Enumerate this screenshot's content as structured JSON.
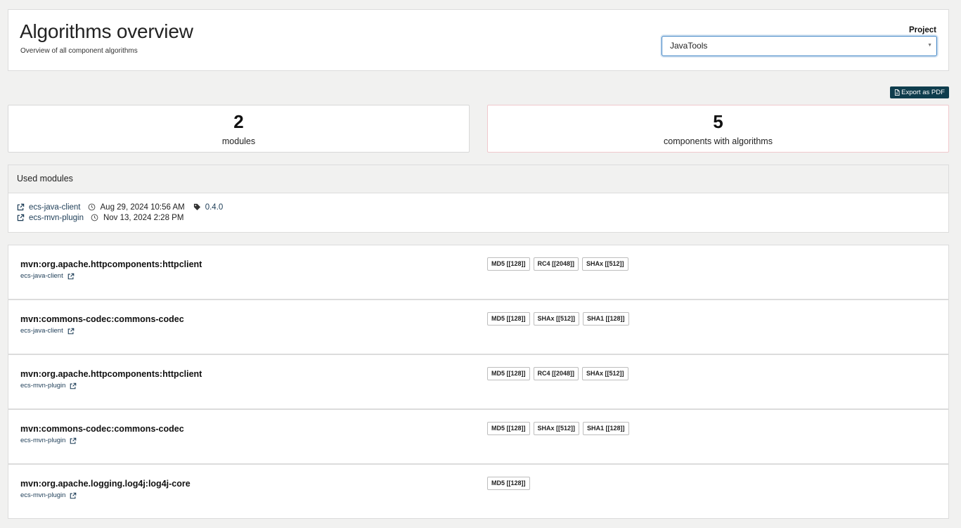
{
  "header": {
    "title": "Algorithms overview",
    "subtitle": "Overview of all component algorithms",
    "project_label": "Project",
    "project_value": "JavaTools"
  },
  "toolbar": {
    "export_label": "Export as PDF"
  },
  "stats": {
    "modules": {
      "value": "2",
      "label": "modules"
    },
    "components": {
      "value": "5",
      "label": "components with algorithms"
    }
  },
  "used_modules": {
    "title": "Used modules",
    "items": [
      {
        "name": "ecs-java-client",
        "date": "Aug 29, 2024 10:56 AM",
        "version": "0.4.0"
      },
      {
        "name": "ecs-mvn-plugin",
        "date": "Nov 13, 2024 2:28 PM"
      }
    ]
  },
  "components": [
    {
      "name": "mvn:org.apache.httpcomponents:httpclient",
      "module": "ecs-java-client",
      "algorithms": [
        "MD5 [[128]]",
        "RC4 [[2048]]",
        "SHAx [[512]]"
      ]
    },
    {
      "name": "mvn:commons-codec:commons-codec",
      "module": "ecs-java-client",
      "algorithms": [
        "MD5 [[128]]",
        "SHAx [[512]]",
        "SHA1 [[128]]"
      ]
    },
    {
      "name": "mvn:org.apache.httpcomponents:httpclient",
      "module": "ecs-mvn-plugin",
      "algorithms": [
        "MD5 [[128]]",
        "RC4 [[2048]]",
        "SHAx [[512]]"
      ]
    },
    {
      "name": "mvn:commons-codec:commons-codec",
      "module": "ecs-mvn-plugin",
      "algorithms": [
        "MD5 [[128]]",
        "SHAx [[512]]",
        "SHA1 [[128]]"
      ]
    },
    {
      "name": "mvn:org.apache.logging.log4j:log4j-core",
      "module": "ecs-mvn-plugin",
      "algorithms": [
        "MD5 [[128]]"
      ]
    }
  ],
  "icons": {
    "external_link": "external-link-icon",
    "clock": "clock-icon",
    "tag": "tag-icon",
    "pdf": "pdf-file-icon",
    "caret": "chevron-down-icon"
  },
  "colors": {
    "accent_dark": "#0f3d4d",
    "select_focus": "#3b82c4",
    "link": "#1d3d57",
    "components_card_border": "#f0c8cc"
  }
}
